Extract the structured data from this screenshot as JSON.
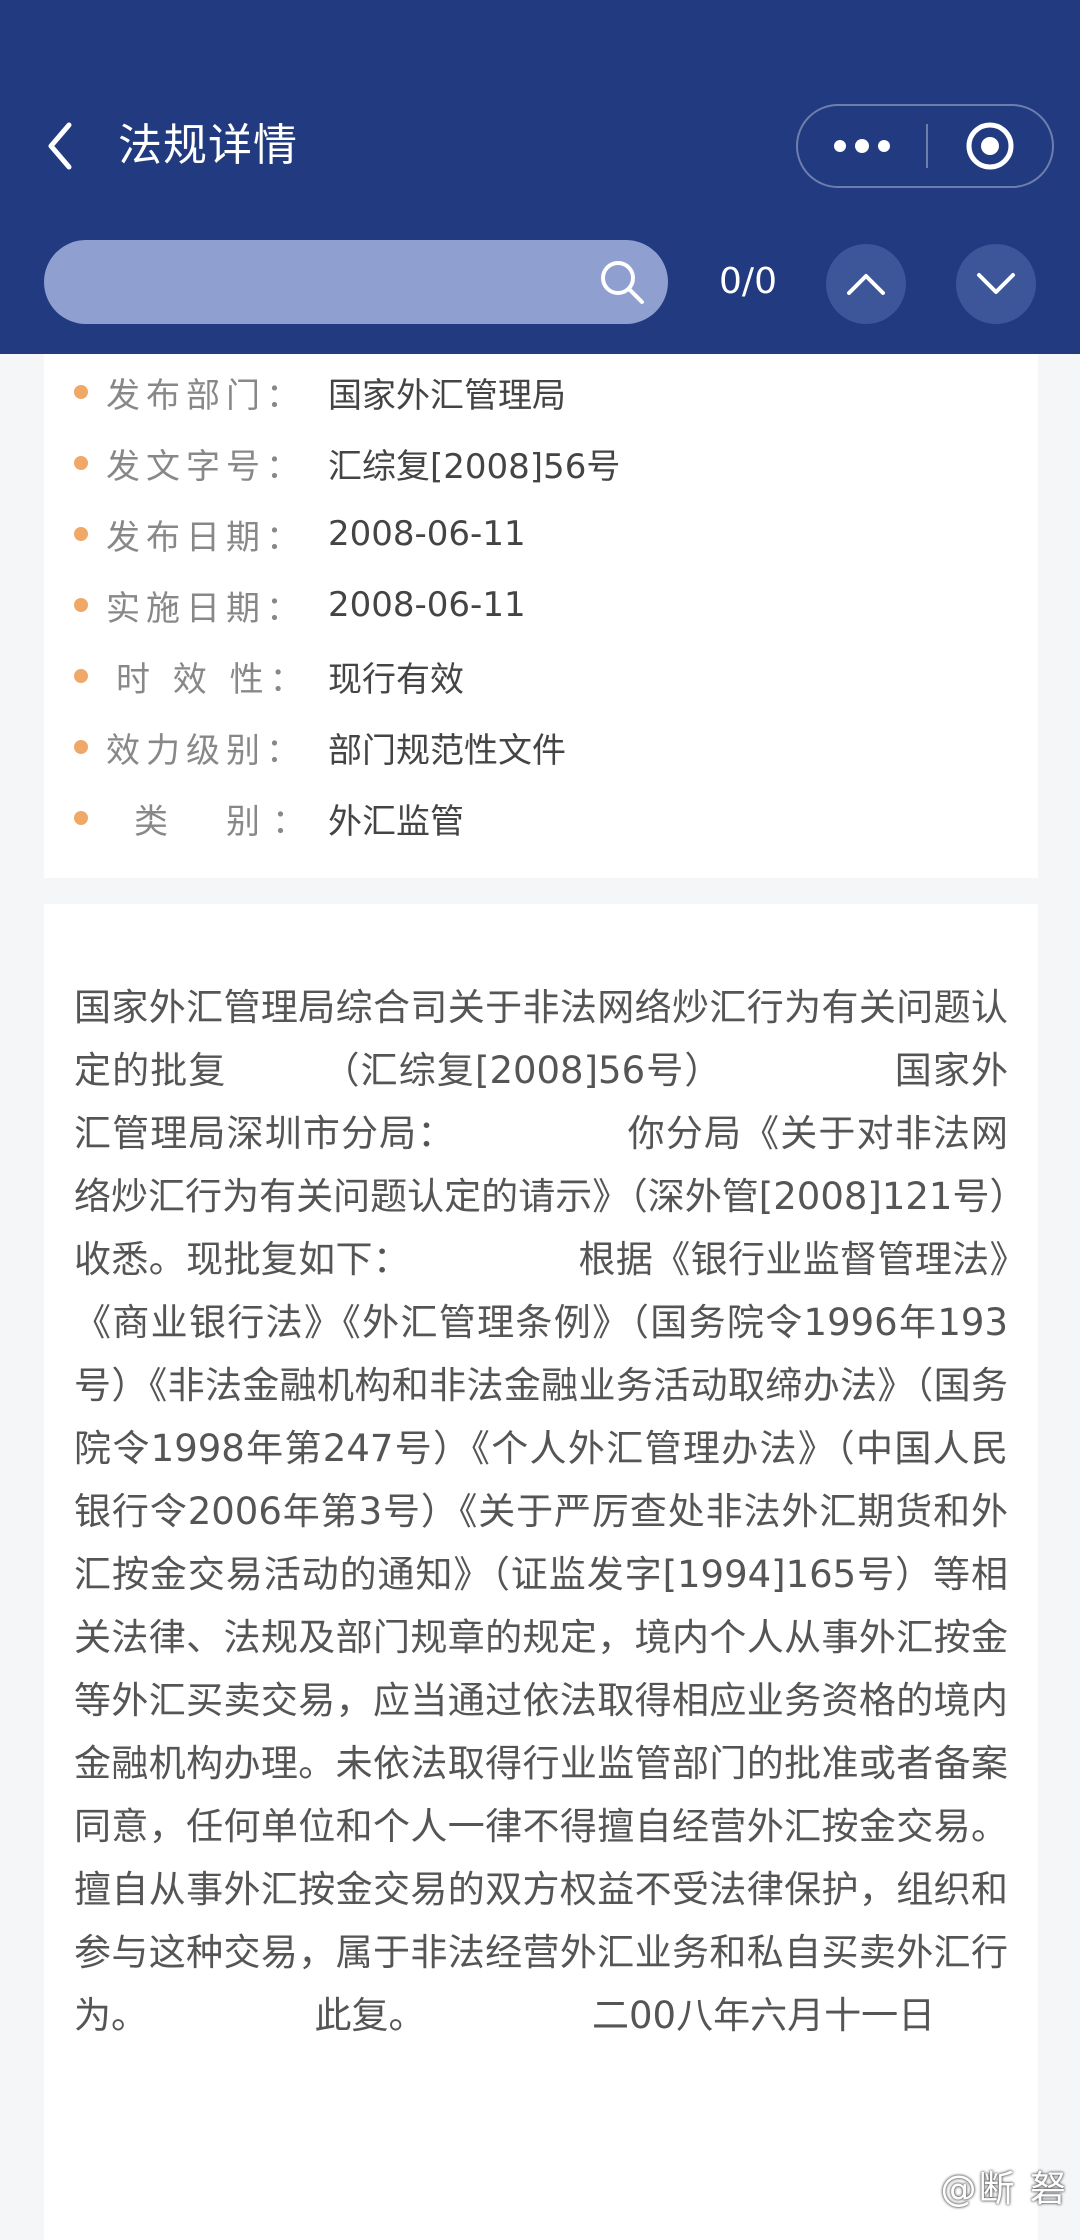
{
  "header": {
    "title": "法规详情",
    "bg_color": "#213a80"
  },
  "search": {
    "placeholder": "",
    "value": "",
    "counter": "0/0"
  },
  "info": [
    {
      "label": "发布部门：",
      "value": "国家外汇管理局"
    },
    {
      "label": "发文字号：",
      "value": "汇综复[2008]56号"
    },
    {
      "label": "发布日期：",
      "value": "2008-06-11"
    },
    {
      "label": "实施日期：",
      "value": "2008-06-11"
    },
    {
      "label": "时 效 性：",
      "value": "现行有效"
    },
    {
      "label": "效力级别：",
      "value": "部门规范性文件"
    },
    {
      "label": "类　别：",
      "value": "外汇监管"
    }
  ],
  "content": {
    "body": "国家外汇管理局综合司关于非法网络炒汇行为有关问题认定的批复　　　（汇综复[2008]56号）　　　　　国家外汇管理局深圳市分局：　　　　　你分局《关于对非法网络炒汇行为有关问题认定的请示》（深外管[2008]121号）收悉。现批复如下：　　　　　根据《银行业监督管理法》《商业银行法》《外汇管理条例》（国务院令1996年193号）《非法金融机构和非法金融业务活动取缔办法》（国务院令1998年第247号）《个人外汇管理办法》（中国人民银行令2006年第3号）《关于严厉查处非法外汇期货和外汇按金交易活动的通知》（证监发字[1994]165号）等相关法律、法规及部门规章的规定，境内个人从事外汇按金等外汇买卖交易，应当通过依法取得相应业务资格的境内金融机构办理。未依法取得行业监管部门的批准或者备案同意，任何单位和个人一律不得擅自经营外汇按金交易。擅自从事外汇按金交易的双方权益不受法律保护，组织和参与这种交易，属于非法经营外汇业务和私自买卖外汇行为。　　　　　此复。　　　　　二00八年六月十一日"
  },
  "watermark": "@断 砮"
}
